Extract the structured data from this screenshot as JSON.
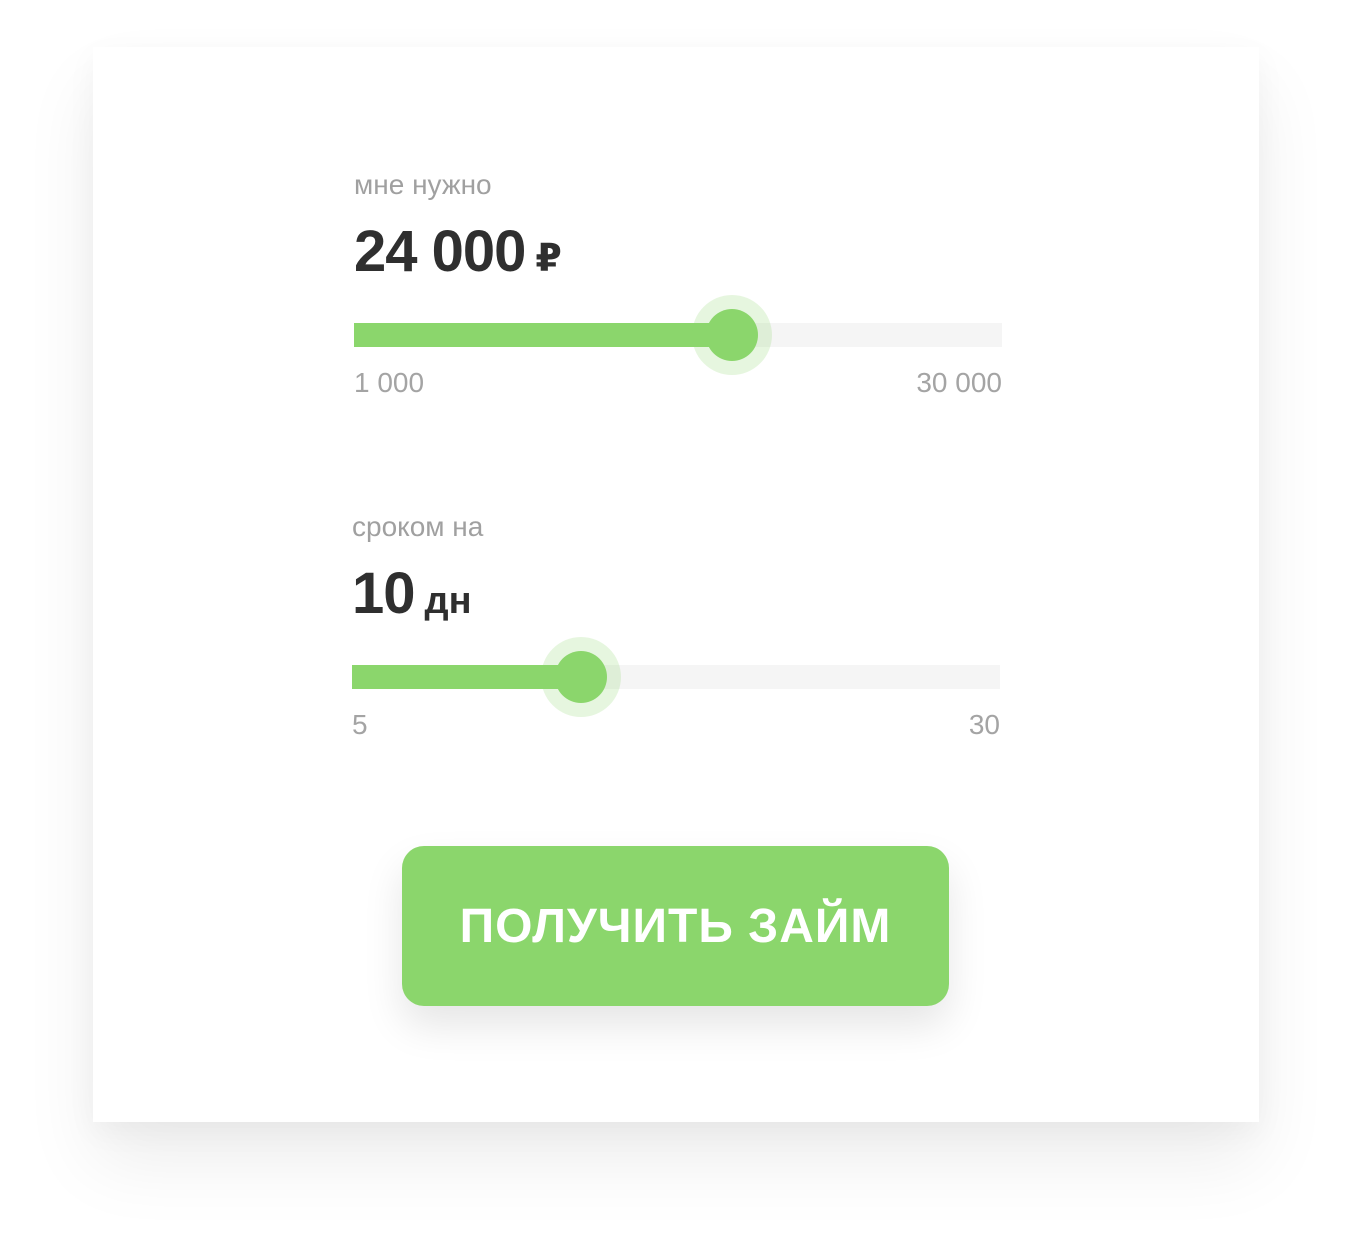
{
  "amount": {
    "label": "мне нужно",
    "value": "24 000",
    "unit": "₽",
    "min_label": "1 000",
    "max_label": "30 000",
    "slider_fraction": 0.583
  },
  "term": {
    "label": "сроком на",
    "value": "10",
    "unit": "дн",
    "min_label": "5",
    "max_label": "30",
    "slider_fraction": 0.354
  },
  "cta": {
    "label": "ПОЛУЧИТЬ ЗАЙМ"
  },
  "colors": {
    "accent": "#8bd66c",
    "track": "#f5f5f5",
    "label": "#a0a0a0",
    "value": "#2f2f2f"
  }
}
